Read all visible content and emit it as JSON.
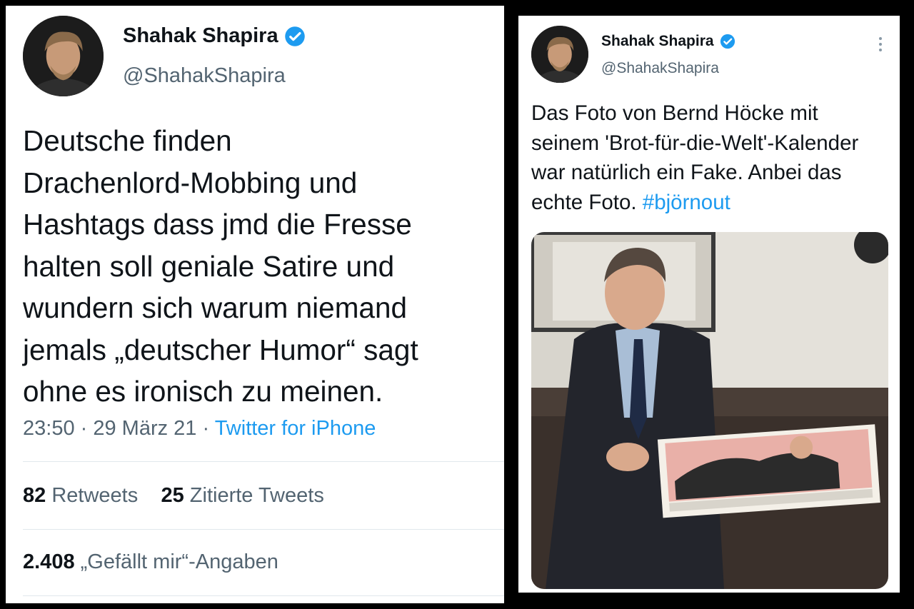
{
  "left_tweet": {
    "author": {
      "name": "Shahak Shapira",
      "handle": "@ShahakShapira",
      "verified_icon": "verified-badge-icon"
    },
    "text_lines": [
      "Deutsche finden",
      "Drachenlord-Mobbing und",
      "Hashtags dass jmd die Fresse",
      "halten soll geniale Satire und",
      "wundern sich warum niemand",
      "jemals „deutscher Humor“ sagt",
      "ohne es ironisch zu meinen."
    ],
    "meta": {
      "time": "23:50",
      "separator": " · ",
      "date": "29 März 21",
      "source": "Twitter for iPhone"
    },
    "stats": {
      "retweets_count": "82",
      "retweets_label": "Retweets",
      "quotes_count": "25",
      "quotes_label": "Zitierte Tweets",
      "likes_count": "2.408",
      "likes_label": "„Gefällt mir“-Angaben"
    }
  },
  "right_tweet": {
    "author": {
      "name": "Shahak Shapira",
      "handle": "@ShahakShapira",
      "verified_icon": "verified-badge-icon"
    },
    "more_icon": "more-vertical-icon",
    "text_lines": [
      "Das Foto von Bernd Höcke mit",
      "seinem 'Brot-für-die-Welt'-Kalender",
      "war natürlich ein Fake. Anbei das",
      "echte Foto. "
    ],
    "hashtag": "#björnout"
  },
  "colors": {
    "accent": "#1d9bf0",
    "text": "#0f1419",
    "secondary": "#536471",
    "divider": "#e1e8ed"
  }
}
